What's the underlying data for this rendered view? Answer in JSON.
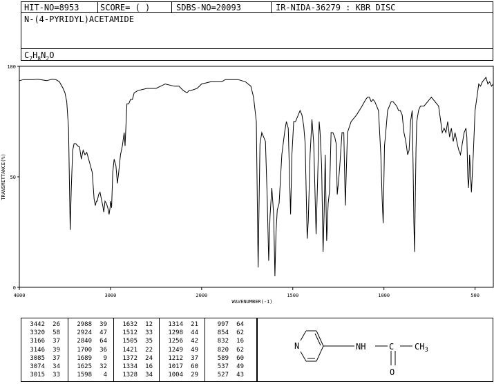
{
  "header": {
    "hit_no": "HIT-NO=8953",
    "score": "SCORE=  (   )",
    "sdbs_no": "SDBS-NO=20093",
    "ir_info": "IR-NIDA-36279 : KBR DISC"
  },
  "compound": {
    "name": "N-(4-PYRIDYL)ACETAMIDE",
    "formula_parts": [
      "C",
      "7",
      "H",
      "8",
      "N",
      "2",
      "O"
    ]
  },
  "chart_data": {
    "type": "line",
    "xlabel": "WAVENUMBER(-1)",
    "ylabel": "TRANSMITTANCE(%)",
    "xlim": [
      4000,
      400
    ],
    "ylim": [
      0,
      100
    ],
    "x_ticks": [
      4000,
      3000,
      2000,
      1500,
      1000,
      500
    ],
    "y_ticks": [
      0,
      50,
      100
    ],
    "series": [
      {
        "x": [
          4000,
          3950,
          3850,
          3800,
          3700,
          3640,
          3600,
          3560,
          3520,
          3500,
          3480,
          3460,
          3450,
          3442,
          3430,
          3415,
          3400,
          3380,
          3360,
          3340,
          3320,
          3300,
          3280,
          3260,
          3240,
          3220,
          3200,
          3180,
          3166,
          3155,
          3146,
          3130,
          3115,
          3100,
          3085,
          3074,
          3060,
          3045,
          3030,
          3015,
          3005,
          2998,
          2988,
          2975,
          2960,
          2940,
          2924,
          2910,
          2890,
          2870,
          2850,
          2840,
          2820,
          2800,
          2780,
          2760,
          2740,
          2700,
          2600,
          2500,
          2400,
          2300,
          2250,
          2200,
          2160,
          2140,
          2120,
          2050,
          2000,
          1950,
          1900,
          1890,
          1870,
          1850,
          1800,
          1760,
          1730,
          1715,
          1700,
          1690,
          1680,
          1670,
          1660,
          1650,
          1640,
          1632,
          1625,
          1615,
          1605,
          1598,
          1592,
          1585,
          1575,
          1560,
          1545,
          1535,
          1525,
          1512,
          1505,
          1495,
          1485,
          1470,
          1460,
          1450,
          1440,
          1432,
          1421,
          1415,
          1405,
          1395,
          1385,
          1372,
          1365,
          1355,
          1350,
          1342,
          1334,
          1328,
          1322,
          1314,
          1306,
          1298,
          1290,
          1280,
          1270,
          1262,
          1256,
          1249,
          1242,
          1230,
          1220,
          1212,
          1200,
          1180,
          1150,
          1120,
          1100,
          1090,
          1080,
          1070,
          1060,
          1050,
          1040,
          1030,
          1017,
          1010,
          1004,
          997,
          990,
          980,
          970,
          960,
          950,
          940,
          930,
          920,
          910,
          900,
          890,
          880,
          870,
          862,
          854,
          845,
          840,
          836,
          832,
          828,
          824,
          820,
          810,
          800,
          780,
          760,
          740,
          720,
          700,
          690,
          680,
          670,
          660,
          650,
          640,
          630,
          620,
          610,
          600,
          595,
          589,
          580,
          570,
          560,
          550,
          545,
          540,
          537,
          533,
          530,
          527,
          520,
          510,
          500,
          490,
          480,
          470,
          460,
          450,
          440,
          430,
          420,
          410,
          400
        ],
        "y": [
          93.5,
          94,
          94,
          94.2,
          93.5,
          94.2,
          94,
          93,
          90,
          88,
          84,
          72,
          45,
          26,
          45,
          62,
          65,
          65,
          64,
          63.5,
          58,
          62,
          60,
          61,
          58,
          55,
          52,
          40,
          37,
          39,
          39,
          42,
          43,
          40,
          37,
          34,
          39,
          38,
          36,
          33,
          36,
          39,
          36,
          52,
          58,
          55,
          47,
          52,
          60,
          64,
          70,
          64,
          83,
          83,
          85,
          85,
          88,
          89,
          90,
          90,
          92,
          91,
          91,
          89,
          88,
          89,
          89,
          90,
          92,
          93,
          93,
          93,
          94,
          94,
          94,
          93,
          91,
          86,
          75,
          9,
          65,
          70,
          68,
          66,
          40,
          12,
          32,
          45,
          33,
          5,
          25,
          35,
          38,
          60,
          70,
          75,
          72,
          33,
          60,
          75,
          75,
          78,
          80,
          78,
          73,
          65,
          22,
          30,
          60,
          76,
          65,
          24,
          45,
          75,
          70,
          55,
          16,
          34,
          60,
          21,
          38,
          44,
          70,
          70,
          68,
          65,
          42,
          48,
          55,
          70,
          70,
          37,
          70,
          75,
          78,
          82,
          85,
          86,
          86,
          84,
          85,
          84,
          82,
          80,
          60,
          40,
          29,
          64,
          70,
          80,
          82,
          84,
          84,
          83,
          82,
          80,
          80,
          78,
          70,
          66,
          60,
          62,
          75,
          80,
          55,
          30,
          16,
          40,
          62,
          75,
          80,
          82,
          82,
          84,
          86,
          84,
          82,
          76,
          70,
          72,
          70,
          75,
          68,
          72,
          66,
          70,
          66,
          64,
          62,
          60,
          65,
          70,
          72,
          68,
          50,
          45,
          50,
          60,
          55,
          43,
          60,
          80,
          86,
          92,
          91,
          93,
          94,
          95,
          92,
          93,
          91,
          92
        ]
      }
    ]
  },
  "peaks": [
    [
      "3442",
      "26"
    ],
    [
      "3320",
      "58"
    ],
    [
      "3166",
      "37"
    ],
    [
      "3146",
      "39"
    ],
    [
      "3085",
      "37"
    ],
    [
      "3074",
      "34"
    ],
    [
      "3015",
      "33"
    ],
    [
      "2988",
      "39"
    ],
    [
      "2924",
      "47"
    ],
    [
      "2840",
      "64"
    ],
    [
      "1700",
      "36"
    ],
    [
      "1689",
      "9"
    ],
    [
      "1625",
      "32"
    ],
    [
      "1598",
      "4"
    ],
    [
      "1632",
      "12"
    ],
    [
      "1512",
      "33"
    ],
    [
      "1505",
      "35"
    ],
    [
      "1421",
      "22"
    ],
    [
      "1372",
      "24"
    ],
    [
      "1334",
      "16"
    ],
    [
      "1328",
      "34"
    ],
    [
      "1314",
      "21"
    ],
    [
      "1298",
      "44"
    ],
    [
      "1256",
      "42"
    ],
    [
      "1249",
      "49"
    ],
    [
      "1212",
      "37"
    ],
    [
      "1017",
      "60"
    ],
    [
      "1004",
      "29"
    ],
    [
      "997",
      "64"
    ],
    [
      "854",
      "62"
    ],
    [
      "832",
      "16"
    ],
    [
      "820",
      "62"
    ],
    [
      "589",
      "60"
    ],
    [
      "537",
      "49"
    ],
    [
      "527",
      "43"
    ]
  ],
  "structure": {
    "nh_label": "NH",
    "c_label": "C",
    "ch3_label": "CH",
    "ch3_sub": "3",
    "o_label": "O",
    "n_label": "N"
  }
}
